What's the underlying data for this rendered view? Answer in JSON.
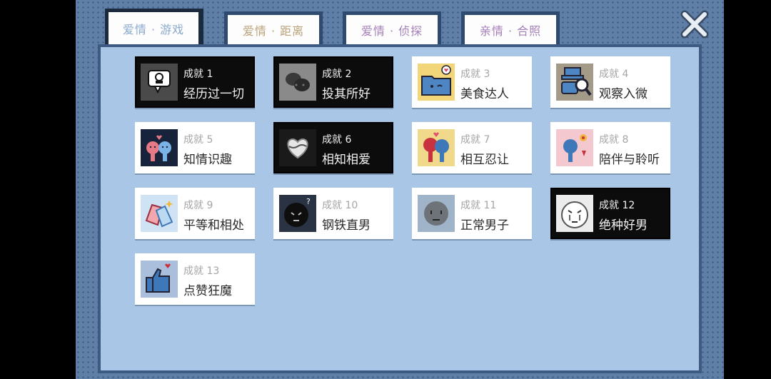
{
  "tabs": [
    {
      "label": "爱情 · 游戏",
      "color": "#8aa9cf",
      "active": true
    },
    {
      "label": "爱情 · 距离",
      "color": "#b9a27a",
      "active": false
    },
    {
      "label": "爱情 · 侦探",
      "color": "#a57fb8",
      "active": false
    },
    {
      "label": "亲情 · 合照",
      "color": "#a57fb8",
      "active": false
    }
  ],
  "close_icon": "close-x-icon",
  "achievements": [
    {
      "title": "成就 1",
      "name": "经历过一切",
      "unlocked": false,
      "icon": "speech-bubble-face-icon"
    },
    {
      "title": "成就 2",
      "name": "投其所好",
      "unlocked": false,
      "icon": "two-bubbles-icon"
    },
    {
      "title": "成就 3",
      "name": "美食达人",
      "unlocked": true,
      "icon": "folder-heart-icon"
    },
    {
      "title": "成就 4",
      "name": "观察入微",
      "unlocked": true,
      "icon": "magnifier-hat-icon"
    },
    {
      "title": "成就 5",
      "name": "知情识趣",
      "unlocked": true,
      "icon": "couple-heart-icon"
    },
    {
      "title": "成就 6",
      "name": "相知相爱",
      "unlocked": false,
      "icon": "wrapped-heart-icon"
    },
    {
      "title": "成就 7",
      "name": "相互忍让",
      "unlocked": true,
      "icon": "couple-kiss-icon"
    },
    {
      "title": "成就 8",
      "name": "陪伴与聆听",
      "unlocked": true,
      "icon": "listening-flower-icon"
    },
    {
      "title": "成就 9",
      "name": "平等和相处",
      "unlocked": true,
      "icon": "high-five-icon"
    },
    {
      "title": "成就 10",
      "name": "钢铁直男",
      "unlocked": true,
      "icon": "confused-face-icon"
    },
    {
      "title": "成就 11",
      "name": "正常男子",
      "unlocked": true,
      "icon": "gray-face-icon"
    },
    {
      "title": "成就 12",
      "name": "绝种好男",
      "unlocked": false,
      "icon": "crying-face-icon"
    },
    {
      "title": "成就 13",
      "name": "点赞狂魔",
      "unlocked": true,
      "icon": "thumbs-up-heart-icon"
    }
  ]
}
